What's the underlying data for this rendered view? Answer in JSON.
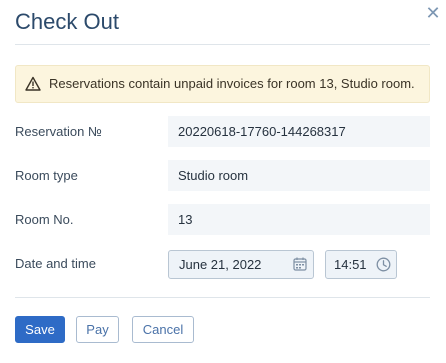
{
  "dialog": {
    "title": "Check Out",
    "close_icon": "close-icon"
  },
  "alert": {
    "icon": "warning-icon",
    "message": "Reservations contain unpaid invoices for room 13, Studio room."
  },
  "fields": {
    "reservation": {
      "label": "Reservation №",
      "value": "20220618-17760-144268317"
    },
    "room_type": {
      "label": "Room type",
      "value": "Studio room"
    },
    "room_no": {
      "label": "Room No.",
      "value": "13"
    },
    "datetime": {
      "label": "Date and time",
      "date": "June 21, 2022",
      "time": "14:51",
      "date_icon": "calendar-icon",
      "time_icon": "clock-icon"
    }
  },
  "buttons": {
    "save": "Save",
    "pay": "Pay",
    "cancel": "Cancel"
  },
  "colors": {
    "primary": "#2e6bc6",
    "alert_bg": "#fcf5de",
    "field_bg": "#f3f6f9"
  }
}
